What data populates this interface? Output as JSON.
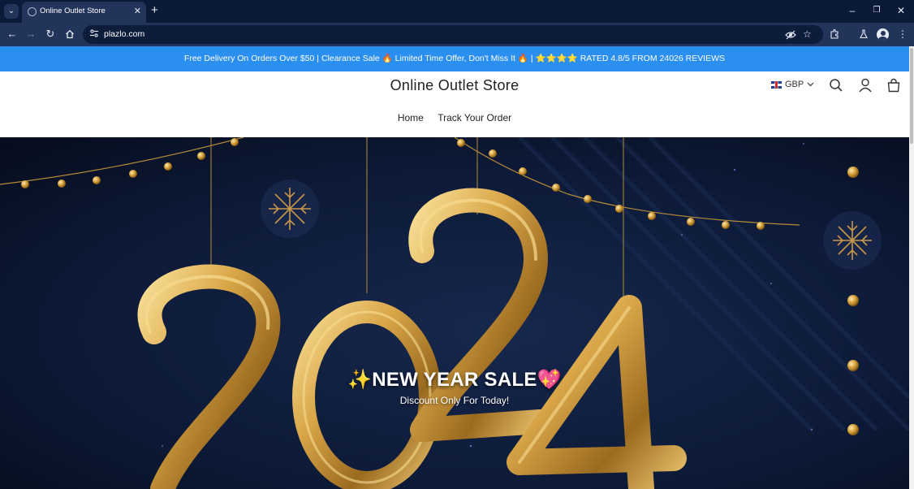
{
  "browser": {
    "tab_title": "Online Outlet Store",
    "url": "plazlo.com",
    "icons": [
      "tab-search-icon",
      "globe-icon",
      "close-icon",
      "plus-icon",
      "minimize-icon",
      "restore-icon",
      "close-window-icon",
      "back-icon",
      "forward-icon",
      "reload-icon",
      "home-icon",
      "site-info-icon",
      "eye-off-icon",
      "star-icon",
      "extensions-icon",
      "labs-flask-icon",
      "profile-avatar-icon",
      "kebab-menu-icon"
    ]
  },
  "announcement": {
    "text": "Free Delivery On Orders Over $50 | Clearance Sale 🔥 Limited Time Offer, Don't Miss It 🔥 | ⭐⭐⭐⭐ RATED 4.8/5 FROM 24026 REVIEWS",
    "background": "#2b8ff0"
  },
  "header": {
    "store_name": "Online Outlet Store",
    "currency": "GBP",
    "nav": [
      "Home",
      "Track Your Order"
    ]
  },
  "hero": {
    "year": "2024",
    "title": "✨NEW YEAR SALE💖",
    "subtitle": "Discount Only For Today!",
    "gold": "#d9a648",
    "background": "#0b1530"
  }
}
